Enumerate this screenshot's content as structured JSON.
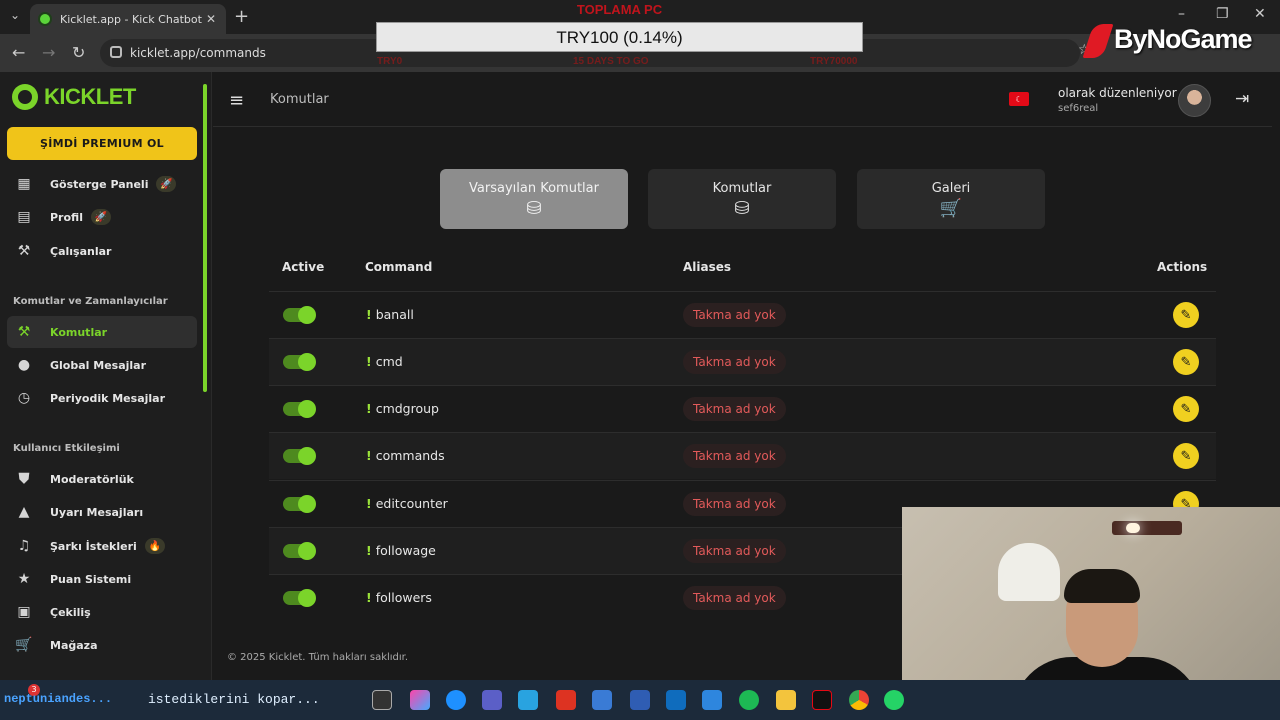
{
  "browser": {
    "tab_title": "Kicklet.app - Kick Chatbot and",
    "url": "kicklet.app/commands"
  },
  "overlay": {
    "donation_title": "TOPLAMA PC",
    "donation_amount": "TRY100 (0.14%)",
    "donation_left": "TRY0",
    "donation_mid": "15 DAYS TO GO",
    "donation_right": "TRY70000",
    "brand": "ByNoGame"
  },
  "sidebar": {
    "brand": "KICKLET",
    "premium_label": "ŞİMDİ PREMIUM OL",
    "items_top": [
      {
        "label": "Gösterge Paneli",
        "icon": "dashboard-icon",
        "badge": "🚀"
      },
      {
        "label": "Profil",
        "icon": "clipboard-icon",
        "badge": "🚀"
      },
      {
        "label": "Çalışanlar",
        "icon": "tools-icon",
        "badge": ""
      }
    ],
    "section_commands": "Komutlar ve Zamanlayıcılar",
    "items_commands": [
      {
        "label": "Komutlar",
        "icon": "hammer-icon",
        "active": true
      },
      {
        "label": "Global Mesajlar",
        "icon": "chat-icon"
      },
      {
        "label": "Periyodik Mesajlar",
        "icon": "clock-icon"
      }
    ],
    "section_engagement": "Kullanıcı Etkileşimi",
    "items_engagement": [
      {
        "label": "Moderatörlük",
        "icon": "shield-icon",
        "badge": ""
      },
      {
        "label": "Uyarı Mesajları",
        "icon": "warning-icon",
        "badge": ""
      },
      {
        "label": "Şarkı İstekleri",
        "icon": "music-icon",
        "badge": "🔥"
      },
      {
        "label": "Puan Sistemi",
        "icon": "star-icon",
        "badge": ""
      },
      {
        "label": "Çekiliş",
        "icon": "gift-icon",
        "badge": ""
      },
      {
        "label": "Mağaza",
        "icon": "cart-icon",
        "badge": ""
      }
    ]
  },
  "header": {
    "page_title": "Komutlar",
    "user_name": "olarak düzenleniyor",
    "user_handle": "sef6real"
  },
  "tabs": [
    {
      "label": "Varsayılan Komutlar",
      "icon": "database-check-icon",
      "selected": true
    },
    {
      "label": "Komutlar",
      "icon": "database-check-icon",
      "selected": false
    },
    {
      "label": "Galeri",
      "icon": "cart-icon",
      "selected": false
    }
  ],
  "table": {
    "columns": [
      "Active",
      "Command",
      "Aliases",
      "Actions"
    ],
    "rows": [
      {
        "command": "banall",
        "alias": "Takma ad yok",
        "active": true
      },
      {
        "command": "cmd",
        "alias": "Takma ad yok",
        "active": true
      },
      {
        "command": "cmdgroup",
        "alias": "Takma ad yok",
        "active": true
      },
      {
        "command": "commands",
        "alias": "Takma ad yok",
        "active": true
      },
      {
        "command": "editcounter",
        "alias": "Takma ad yok",
        "active": true
      },
      {
        "command": "followage",
        "alias": "Takma ad yok",
        "active": true
      },
      {
        "command": "followers",
        "alias": "Takma ad yok",
        "active": true
      }
    ]
  },
  "footer": "© 2025 Kicklet. Tüm hakları saklıdır.",
  "taskbar": {
    "ticker": "neptuniandes...",
    "ticker2": "istediklerini kopar...",
    "badge_count": "3"
  },
  "colors": {
    "accent": "#7bd42a",
    "premium": "#f0c419",
    "alias_text": "#e25a5a",
    "edit_button": "#f0d020"
  }
}
